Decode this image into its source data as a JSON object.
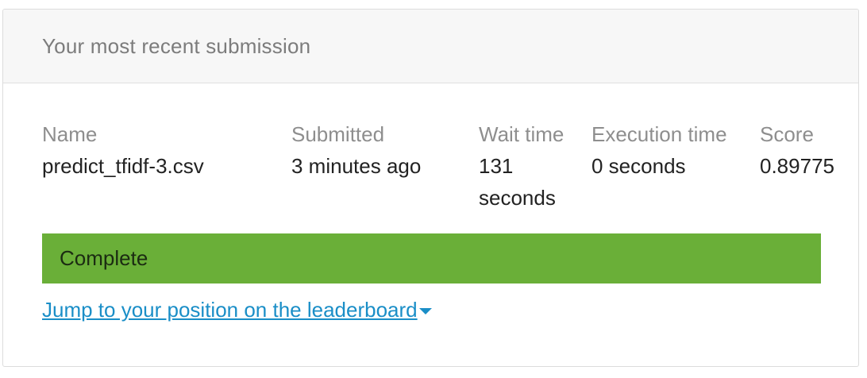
{
  "card": {
    "title": "Your most recent submission"
  },
  "columns": {
    "name": {
      "header": "Name",
      "value": "predict_tfidf-3.csv"
    },
    "submitted": {
      "header": "Submitted",
      "value": "3 minutes ago"
    },
    "wait_time": {
      "header": "Wait time",
      "value": "131 seconds"
    },
    "execution_time": {
      "header": "Execution time",
      "value": "0 seconds"
    },
    "score": {
      "header": "Score",
      "value": "0.89775"
    }
  },
  "status": {
    "label": "Complete",
    "color": "#6aaf38"
  },
  "leaderboard_link": {
    "label": "Jump to your position on the leaderboard",
    "icon": "caret-down-icon",
    "color": "#1a8ec7"
  }
}
